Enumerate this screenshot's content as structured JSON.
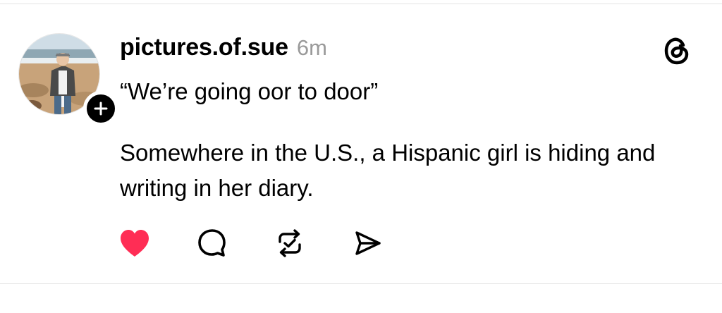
{
  "post": {
    "author": {
      "username": "pictures.of.sue",
      "avatar_icon": "profile-photo-avatar",
      "follow_icon": "plus-icon"
    },
    "timestamp": "6m",
    "header_icon": "threads-logo-icon",
    "quote": "“We’re going oor to door”",
    "body": "Somewhere in the U.S., a Hispanic girl is hiding and writing in her diary.",
    "actions": [
      {
        "name": "like",
        "icon": "heart-icon",
        "state": "liked"
      },
      {
        "name": "reply",
        "icon": "comment-icon"
      },
      {
        "name": "repost",
        "icon": "repost-icon"
      },
      {
        "name": "share",
        "icon": "send-icon"
      }
    ]
  },
  "colors": {
    "text": "#000000",
    "muted": "#9a9a9a",
    "like_active": "#ff2d55",
    "divider": "#e3e3e3",
    "background": "#ffffff"
  }
}
